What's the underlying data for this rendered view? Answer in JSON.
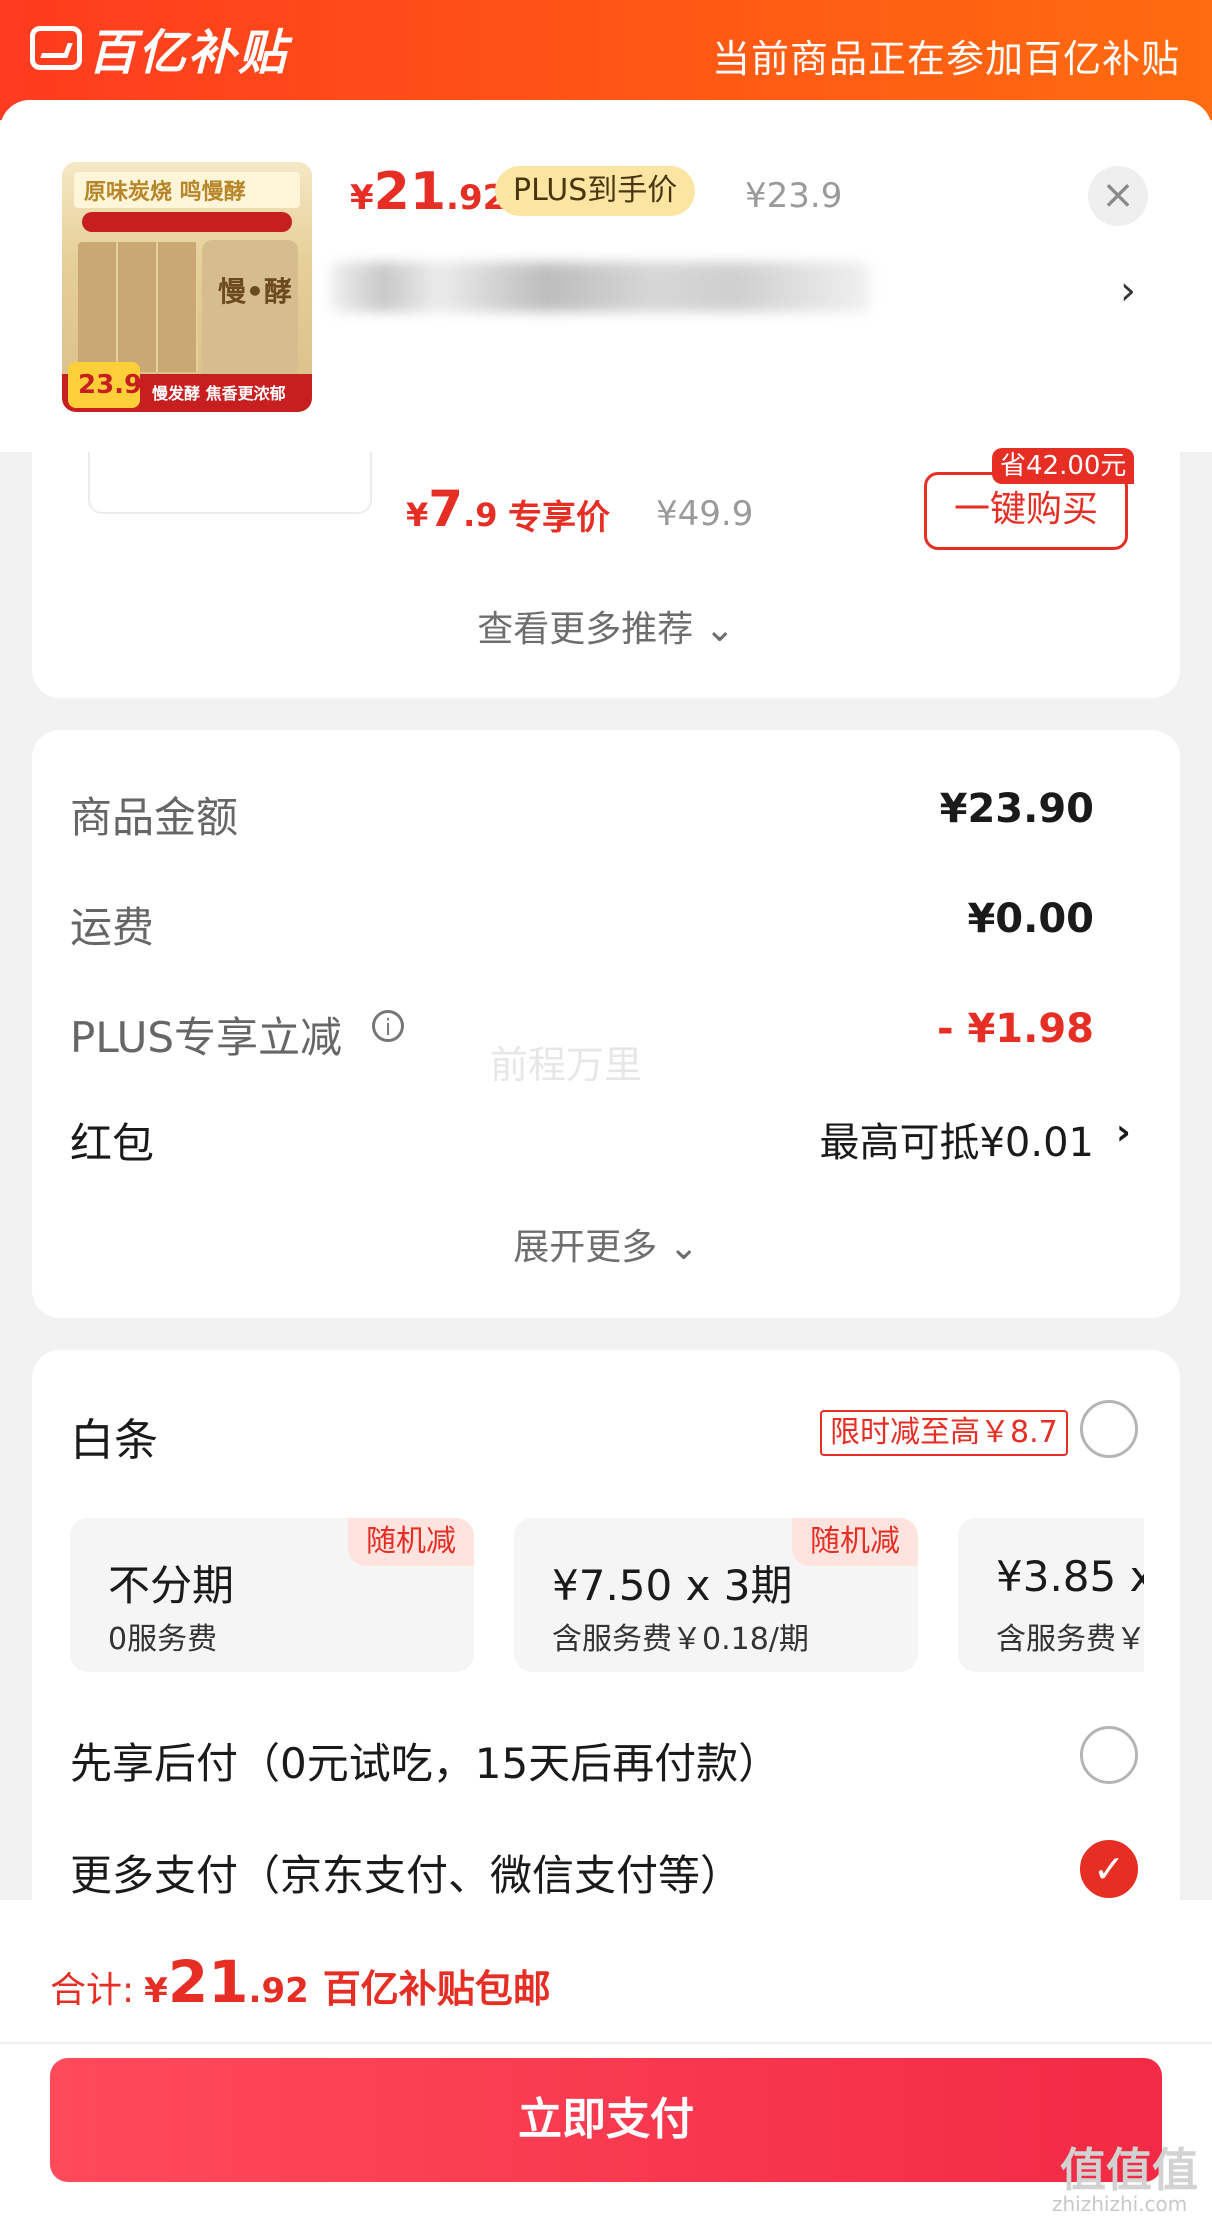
{
  "banner": {
    "brand": "百亿补贴",
    "note": "当前商品正在参加百亿补贴"
  },
  "product": {
    "thumb_title": "原味炭烧 鸣慢酵",
    "thumb_bag": "慢•酵",
    "thumb_slogan": "慢发酵 焦香更浓郁",
    "thumb_price": "23.9",
    "price_symbol": "¥",
    "price_int": "21",
    "price_dec": ".92",
    "plus_label": "PLUS到手价",
    "original_price": "¥23.9",
    "close": "×",
    "title_chevron": "›"
  },
  "recommend": {
    "price_symbol": "¥",
    "price_int": "7",
    "price_dec": ".9",
    "exclusive_label": "专享价",
    "original_price": "¥49.9",
    "save_tag": "省42.00元",
    "buy_button": "一键购买",
    "more": "查看更多推荐 ⌄"
  },
  "summary": {
    "rows": [
      {
        "label": "商品金额",
        "value": "¥23.90"
      },
      {
        "label": "运费",
        "value": "¥0.00"
      },
      {
        "label": "PLUS专享立减",
        "value": "- ¥1.98"
      },
      {
        "label": "红包",
        "value": "最高可抵¥0.01"
      }
    ],
    "info": "i",
    "watermark": "前程万里",
    "chevron": "›",
    "expand": "展开更多 ⌄"
  },
  "payment": {
    "baitiao_label": "白条",
    "promo": "限时减至高￥8.7",
    "plans": [
      {
        "main": "不分期",
        "sub": "0服务费",
        "badge": "随机减"
      },
      {
        "main": "¥7.50 x 3期",
        "sub": "含服务费￥0.18/期",
        "badge": "随机减"
      },
      {
        "main": "¥3.85 x",
        "sub": "含服务费￥"
      }
    ],
    "later_pay": "先享后付（0元试吃，15天后再付款）",
    "more_pay": "更多支付（京东支付、微信支付等）",
    "selected_mark": "✓"
  },
  "footer": {
    "total_label": "合计:",
    "price_symbol": "¥",
    "price_int": "21",
    "price_dec": ".92",
    "note": "百亿补贴包邮",
    "pay_button": "立即支付"
  },
  "watermark_site": {
    "logo": "值值值",
    "url": "zhizhizhi.com"
  },
  "colors": {
    "brand_orange": "#ff4a1a",
    "price_red": "#e62e24",
    "plus_gold": "#fbe5a2",
    "pay_button": "#f22a45"
  }
}
